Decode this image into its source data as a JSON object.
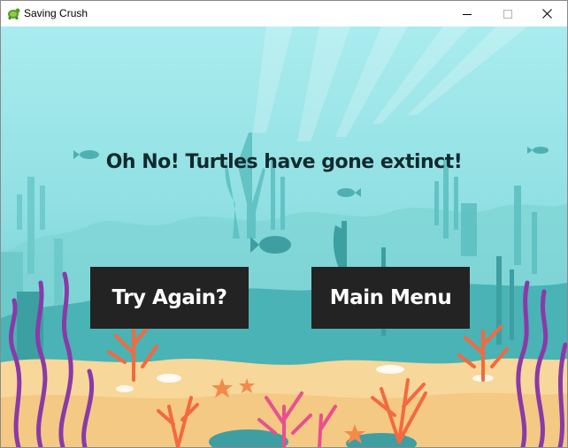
{
  "window": {
    "title": "Saving Crush",
    "controls": {
      "minimize": "minimize-icon",
      "maximize": "maximize-icon",
      "close": "close-icon"
    }
  },
  "game_over": {
    "message": "Oh No! Turtles have gone extinct!",
    "buttons": {
      "try_again": "Try Again?",
      "main_menu": "Main Menu"
    }
  },
  "colors": {
    "water_top": "#a9ecef",
    "water_bottom": "#57c6c7",
    "sand": "#f7d79a",
    "button_bg": "#232323",
    "button_text": "#ffffff",
    "coral_orange": "#f4693f",
    "seaweed_purple": "#8a3aa8",
    "coral_pink": "#e8508e"
  }
}
